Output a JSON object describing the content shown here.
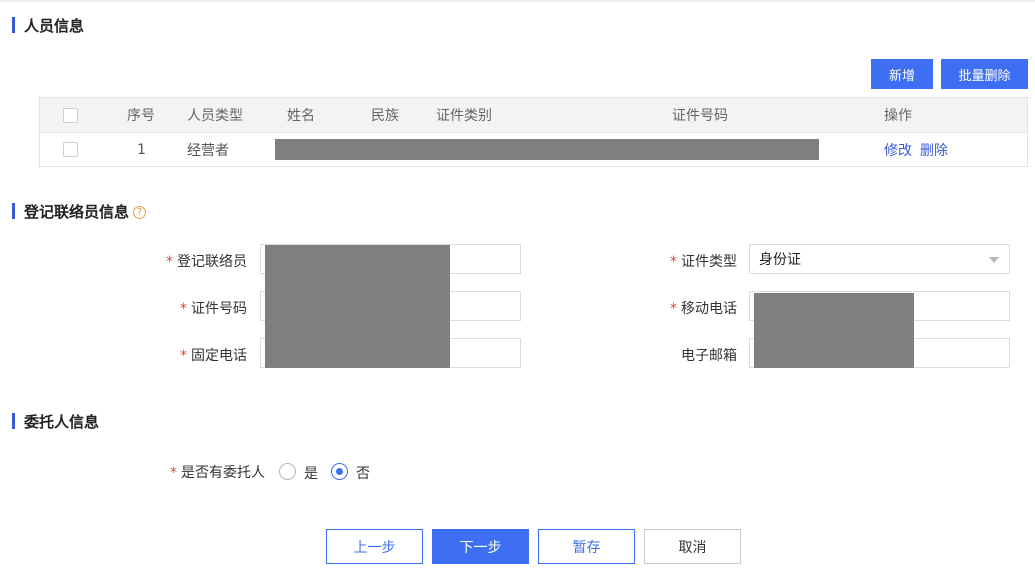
{
  "sections": {
    "personnel": "人员信息",
    "contact": "登记联络员信息",
    "delegate": "委托人信息"
  },
  "toolbar": {
    "add": "新增",
    "batch_delete": "批量删除"
  },
  "table": {
    "headers": [
      "序号",
      "人员类型",
      "姓名",
      "民族",
      "证件类别",
      "证件号码",
      "操作"
    ],
    "rows": [
      {
        "index": "1",
        "type": "经营者",
        "actions": {
          "edit": "修改",
          "delete": "删除"
        }
      }
    ]
  },
  "contact_form": {
    "contact_person": {
      "label": "登记联络员",
      "required": true
    },
    "id_type": {
      "label": "证件类型",
      "required": true,
      "value": "身份证"
    },
    "id_number": {
      "label": "证件号码",
      "required": true
    },
    "mobile": {
      "label": "移动电话",
      "required": true
    },
    "landline": {
      "label": "固定电话",
      "required": true
    },
    "email": {
      "label": "电子邮箱",
      "required": false
    }
  },
  "delegate_form": {
    "question": "是否有委托人",
    "required": true,
    "options": [
      "是",
      "否"
    ],
    "selected": "否"
  },
  "footer": {
    "prev": "上一步",
    "next": "下一步",
    "save": "暂存",
    "cancel": "取消"
  },
  "required_mark": "*",
  "help_mark": "?",
  "colors": {
    "accent": "#3e6ff2",
    "required": "#e0443a",
    "help": "#e0a040"
  }
}
